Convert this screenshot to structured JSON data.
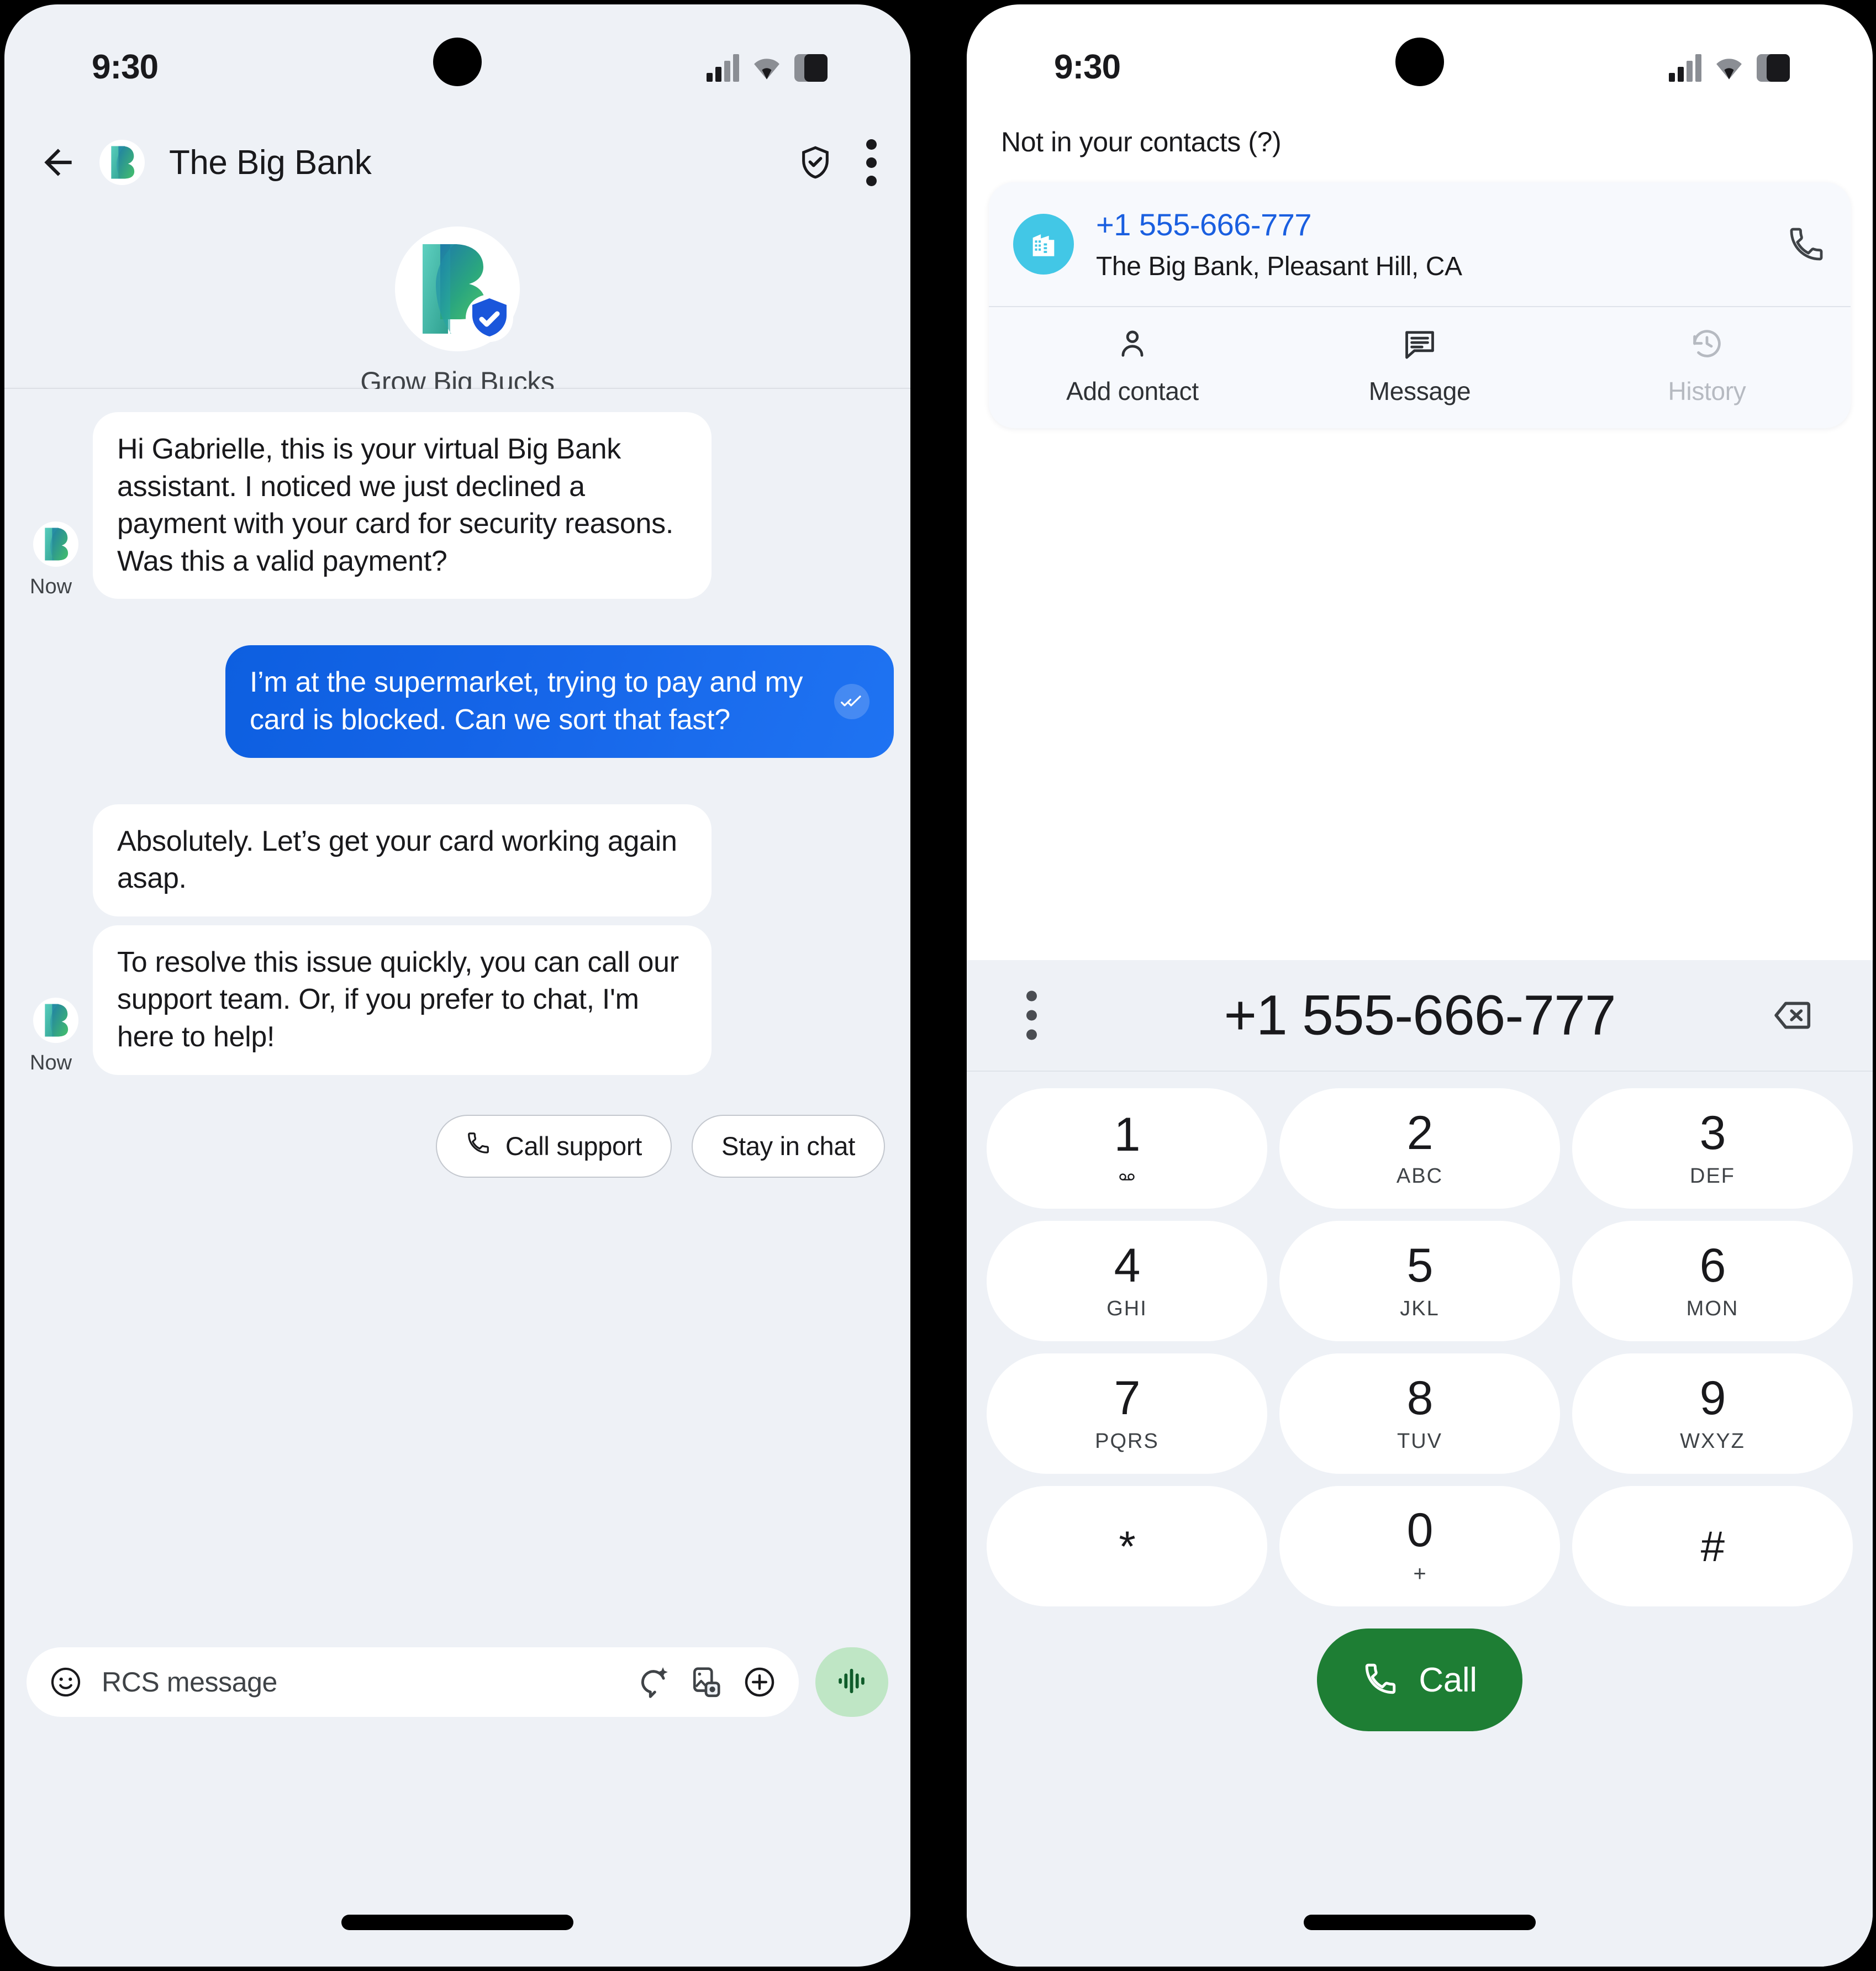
{
  "colors": {
    "accent_blue": "#1a5fe0",
    "bubble_out": "#1565e8",
    "brand_teal": "#35b6a8",
    "brand_green": "#34a853",
    "verified_shield": "#1a56db",
    "call_green": "#1e7e34",
    "voice_green": "#bfe6c5",
    "contact_avatar": "#42c7e6",
    "screen_bg": "#eef1f6"
  },
  "left_phone": {
    "status_bar": {
      "time": "9:30",
      "icons": [
        "signal-icon",
        "wifi-icon",
        "battery-icon"
      ]
    },
    "app_bar": {
      "back_icon": "back-arrow-icon",
      "avatar_icon": "big-bank-logo",
      "title": "The Big Bank",
      "verified_icon": "shield-check-icon",
      "overflow_icon": "more-vertical-icon"
    },
    "brand_header": {
      "logo_icon": "big-bank-verified-logo",
      "tagline": "Grow Big Bucks"
    },
    "messages": [
      {
        "direction": "in",
        "text": "Hi Gabrielle, this is your virtual Big Bank assistant. I noticed we just declined a payment with your card for security reasons. Was this a valid payment?",
        "timestamp": "Now",
        "avatar_icon": "big-bank-logo"
      },
      {
        "direction": "out",
        "text": "I’m at the supermarket, trying to pay and my card is blocked. Can we sort that fast?",
        "status_icon": "double-check-read-icon"
      },
      {
        "direction": "in",
        "text": "Absolutely. Let’s get your card working again asap."
      },
      {
        "direction": "in",
        "text": "To resolve this issue quickly, you can call our support team. Or, if you prefer to chat, I'm here to help!",
        "timestamp": "Now",
        "avatar_icon": "big-bank-logo"
      }
    ],
    "suggestion_chips": [
      {
        "label": "Call support",
        "icon": "phone-icon"
      },
      {
        "label": "Stay in chat",
        "icon": null
      }
    ],
    "composer": {
      "emoji_icon": "emoji-smiley-icon",
      "placeholder": "RCS message",
      "magic_icon": "magic-compose-icon",
      "gallery_icon": "gallery-camera-icon",
      "plus_icon": "plus-circle-icon",
      "voice_icon": "voice-waveform-icon"
    }
  },
  "right_phone": {
    "status_bar": {
      "time": "9:30",
      "icons": [
        "signal-icon",
        "wifi-icon",
        "battery-icon"
      ]
    },
    "contact_panel": {
      "heading": "Not in your contacts (?)",
      "avatar_icon": "business-building-icon",
      "number": "+1 555-666-777",
      "organization": "The Big Bank, Pleasant Hill, CA",
      "call_icon": "phone-icon",
      "actions": [
        {
          "label": "Add contact",
          "icon": "person-add-icon",
          "disabled": false
        },
        {
          "label": "Message",
          "icon": "chat-bubble-icon",
          "disabled": false
        },
        {
          "label": "History",
          "icon": "history-clock-icon",
          "disabled": true
        }
      ]
    },
    "dialer": {
      "overflow_icon": "more-vertical-icon",
      "number": "+1 555-666-777",
      "backspace_icon": "backspace-icon",
      "keys": [
        {
          "digit": "1",
          "sub": "",
          "icon": "voicemail-icon"
        },
        {
          "digit": "2",
          "sub": "ABC",
          "icon": null
        },
        {
          "digit": "3",
          "sub": "DEF",
          "icon": null
        },
        {
          "digit": "4",
          "sub": "GHI",
          "icon": null
        },
        {
          "digit": "5",
          "sub": "JKL",
          "icon": null
        },
        {
          "digit": "6",
          "sub": "MON",
          "icon": null
        },
        {
          "digit": "7",
          "sub": "PQRS",
          "icon": null
        },
        {
          "digit": "8",
          "sub": "TUV",
          "icon": null
        },
        {
          "digit": "9",
          "sub": "WXYZ",
          "icon": null
        },
        {
          "digit": "*",
          "sub": "",
          "icon": null
        },
        {
          "digit": "0",
          "sub": "+",
          "icon": null
        },
        {
          "digit": "#",
          "sub": "",
          "icon": null
        }
      ],
      "call_button": {
        "label": "Call",
        "icon": "phone-icon"
      }
    }
  }
}
